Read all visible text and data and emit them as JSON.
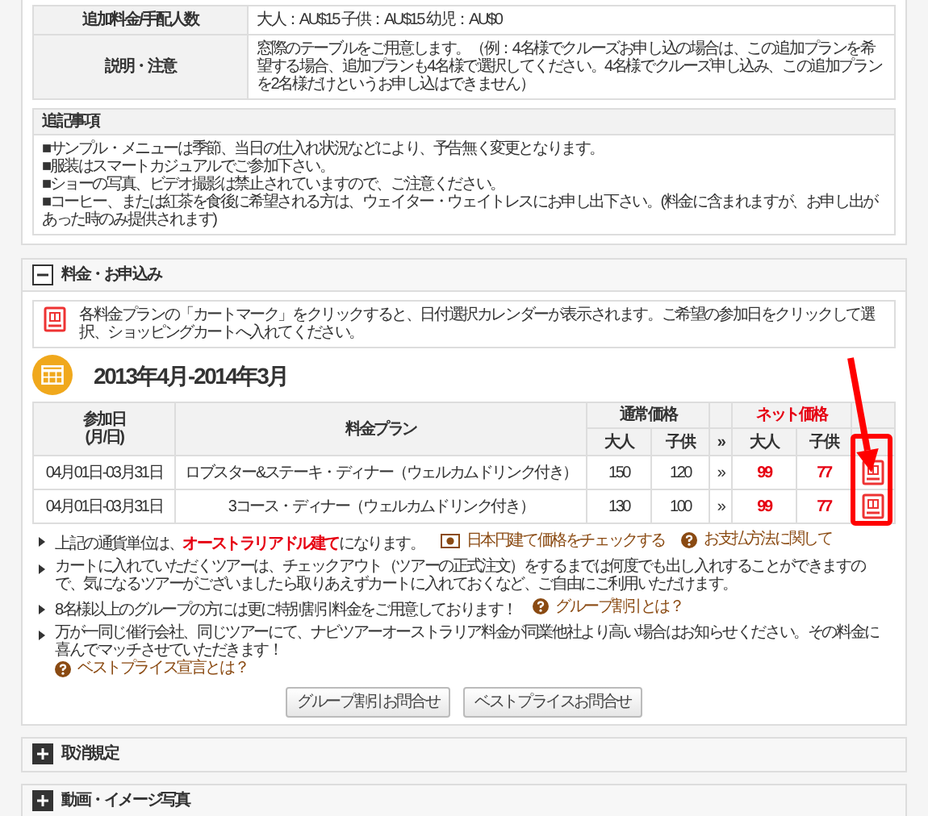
{
  "detail_table": {
    "rows": [
      {
        "label": "追加料金/手配人数",
        "value": "大人：AU$15 子供：AU$15 幼児：AU$0"
      },
      {
        "label": "説明・注意",
        "value": "窓際のテーブルをご用意します。（例：4名様でクルーズお申し込の場合は、この追加プランを希望する場合、追加プランも4名様で選択してください。4名様でクルーズ申し込み、この追加プランを2名様だけというお申し込はできません）"
      }
    ]
  },
  "notes": {
    "title": "追記事項",
    "items": [
      "■サンプル・メニューは季節、当日の仕入れ状況などにより、予告無く変更となります。",
      "■服装はスマートカジュアルでご参加下さい。",
      "■ショーの写真、ビデオ撮影は禁止されていますので、ご注意ください。",
      "■コーヒー、または紅茶を食後に希望される方は、ウェイター・ウェイトレスにお申し出下さい。(料金に含まれますが、お申し出があった時のみ提供されます)"
    ]
  },
  "price_section": {
    "title": "料金・お申込み",
    "expanded": true,
    "notice": "各料金プランの「カートマーク」をクリックすると、日付選択カレンダーが表示されます。ご希望の参加日をクリックして選択、ショッピングカートへ入れてください。",
    "period": "2013年4月-2014年3月",
    "table": {
      "date_header": "参加日\n(月/日)",
      "plan_header": "料金プラン",
      "regular_header": "通常価格",
      "net_header": "ネット価格",
      "regular_adult_header": "大人",
      "regular_child_header": "子供",
      "arrow_header": "»",
      "net_adult_header": "大人",
      "net_child_header": "子供",
      "rows": [
        {
          "date": "04月01日-03月31日",
          "plan": "ロブスター&ステーキ・ディナー（ウェルカムドリンク付き）",
          "regular_adult": "150",
          "regular_child": "120",
          "arrow": "»",
          "net_adult": "99",
          "net_child": "77"
        },
        {
          "date": "04月01日-03月31日",
          "plan": "3コース・ディナー（ウェルカムドリンク付き）",
          "regular_adult": "130",
          "regular_child": "100",
          "arrow": "»",
          "net_adult": "99",
          "net_child": "77"
        }
      ]
    },
    "bullets": [
      {
        "text": "上記の通貨単位は、**オーストラリアドル建て**になります。",
        "links": [
          {
            "text": "日本円建て価格をチェックする",
            "kind": "yen"
          },
          {
            "text": "お支払方法に関して",
            "kind": "help"
          }
        ]
      },
      {
        "text": "カートに入れていただくツアーは、チェックアウト（ツアーの正式注文）をするまでは何度でも出し入れすることができますので、気になるツアーがございましたら取りあえずカートに入れておくなど、ご自由にご利用いただけます。"
      },
      {
        "text": "8名様以上のグループの方には更に特別割引料金をご用意しております！",
        "links": [
          {
            "text": "グループ割引とは？",
            "kind": "help"
          }
        ]
      },
      {
        "text": "万が一同じ催行会社、同じツアーにて、ナビツアーオーストラリア料金が同業他社より高い場合はお知らせください。その料金に喜んでマッチさせていただきます！",
        "links": [
          {
            "text": "ベストプライス宣言とは？",
            "kind": "help"
          }
        ]
      }
    ],
    "buttons": [
      "グループ割引お問合せ",
      "ベストプライスお問合せ"
    ]
  },
  "other_sections": [
    {
      "title": "取消規定",
      "expanded": false
    },
    {
      "title": "動画・イメージ写真",
      "expanded": false
    }
  ]
}
